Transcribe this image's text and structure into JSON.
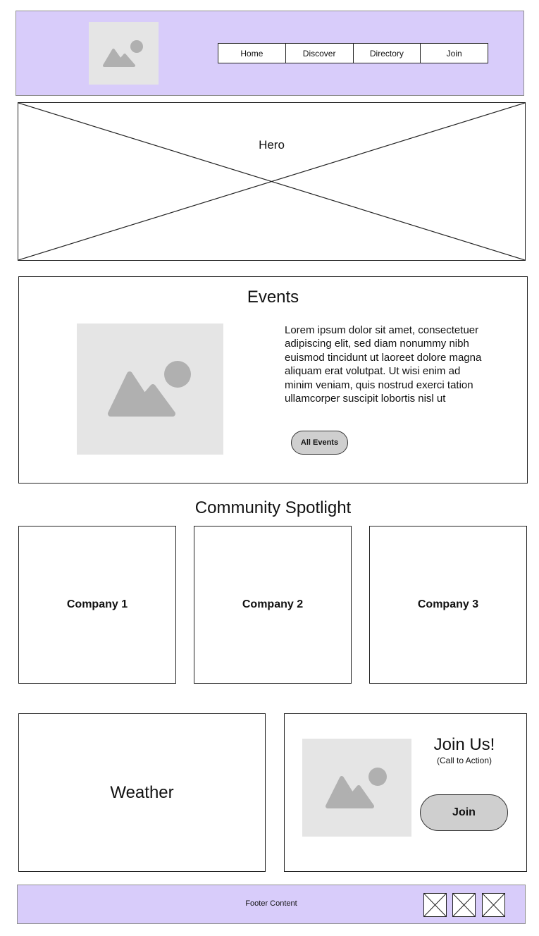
{
  "nav": {
    "items": [
      {
        "label": "Home"
      },
      {
        "label": "Discover"
      },
      {
        "label": "Directory"
      },
      {
        "label": "Join"
      }
    ]
  },
  "hero": {
    "title": "Hero"
  },
  "events": {
    "title": "Events",
    "body": "Lorem ipsum dolor sit amet, consectetuer adipiscing elit, sed diam nonummy nibh euismod tincidunt ut laoreet dolore magna aliquam erat volutpat. Ut wisi enim ad minim veniam, quis nostrud exerci tation ullamcorper suscipit lobortis nisl ut",
    "button_label": "All Events"
  },
  "spotlight": {
    "title": "Community Spotlight",
    "companies": [
      {
        "label": "Company 1"
      },
      {
        "label": "Company 2"
      },
      {
        "label": "Company 3"
      }
    ]
  },
  "weather": {
    "label": "Weather"
  },
  "join": {
    "title": "Join Us!",
    "subtitle": "(Call to Action)",
    "button_label": "Join"
  },
  "footer": {
    "text": "Footer Content"
  },
  "colors": {
    "header_bg": "#d8ccfa",
    "placeholder_bg": "#e5e5e5",
    "placeholder_icon": "#b0b0b0",
    "button_bg": "#cfcfcf"
  },
  "icons": {
    "image_placeholder": "image-placeholder-icon",
    "social": "placeholder-x-icon"
  }
}
